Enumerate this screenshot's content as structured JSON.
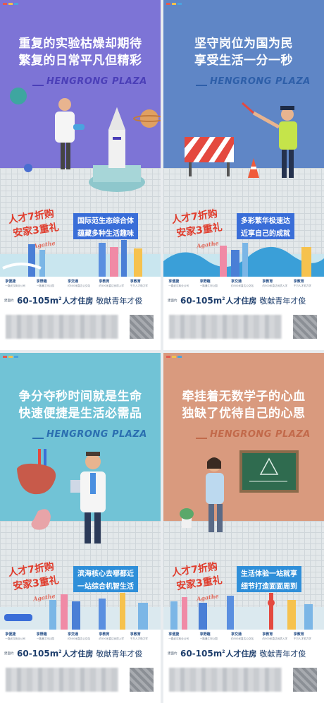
{
  "posters": [
    {
      "headline_line1": "重复的实验枯燥却期待",
      "headline_line2": "繁复的日常平凡但精彩",
      "brand": "HENGRONG PLAZA",
      "tag_line1": "国际范生态综合体",
      "tag_line2": "蕴藏多种生活趣味",
      "character_icon": "scientist-figure-icon",
      "prop_icon": "rocket-icon"
    },
    {
      "headline_line1": "坚守岗位为国为民",
      "headline_line2": "享受生活一分一秒",
      "brand": "HENGRONG PLAZA",
      "tag_line1": "多彩繁华极速达",
      "tag_line2": "近享自己的成就",
      "character_icon": "traffic-police-figure-icon",
      "prop_icon": "roadblock-icon"
    },
    {
      "headline_line1": "争分夺秒时间就是生命",
      "headline_line2": "快速便捷是生活必需品",
      "brand": "HENGRONG PLAZA",
      "tag_line1": "滨海核心去哪都近",
      "tag_line2": "一站综合机智生活",
      "character_icon": "doctor-figure-icon",
      "prop_icon": "organ-model-icon"
    },
    {
      "headline_line1": "牵挂着无数学子的心血",
      "headline_line2": "独缺了优待自己的心思",
      "brand": "HENGRONG PLAZA",
      "tag_line1": "生活体验一站就享",
      "tag_line2": "细节打造面面周到",
      "character_icon": "teacher-figure-icon",
      "prop_icon": "chalkboard-icon"
    }
  ],
  "promo": {
    "line1": "人才7折购",
    "line2": "安家3重礼",
    "script": "Agathe"
  },
  "benefits": [
    {
      "title": "享便捷",
      "desc": "一路武汉商业公司"
    },
    {
      "title": "享野趣",
      "desc": "一路通江河公园"
    },
    {
      "title": "享交通",
      "desc": "约500米直达公交站"
    },
    {
      "title": "享教育",
      "desc": "约500米直达优质入学"
    },
    {
      "title": "享教育",
      "desc": "千万人才助力学"
    }
  ],
  "area": {
    "label": "建面约",
    "main": "60-105m",
    "sup": "2",
    "product": "人才住房",
    "slogan": "敬献青年才俊"
  },
  "colors": {
    "poster1": "#7d74d6",
    "poster2": "#5f86c6",
    "poster3": "#71c3d6",
    "poster4": "#d99a7e",
    "promo_red": "#e03c2c",
    "tag_blue": "#3a6ed8"
  }
}
